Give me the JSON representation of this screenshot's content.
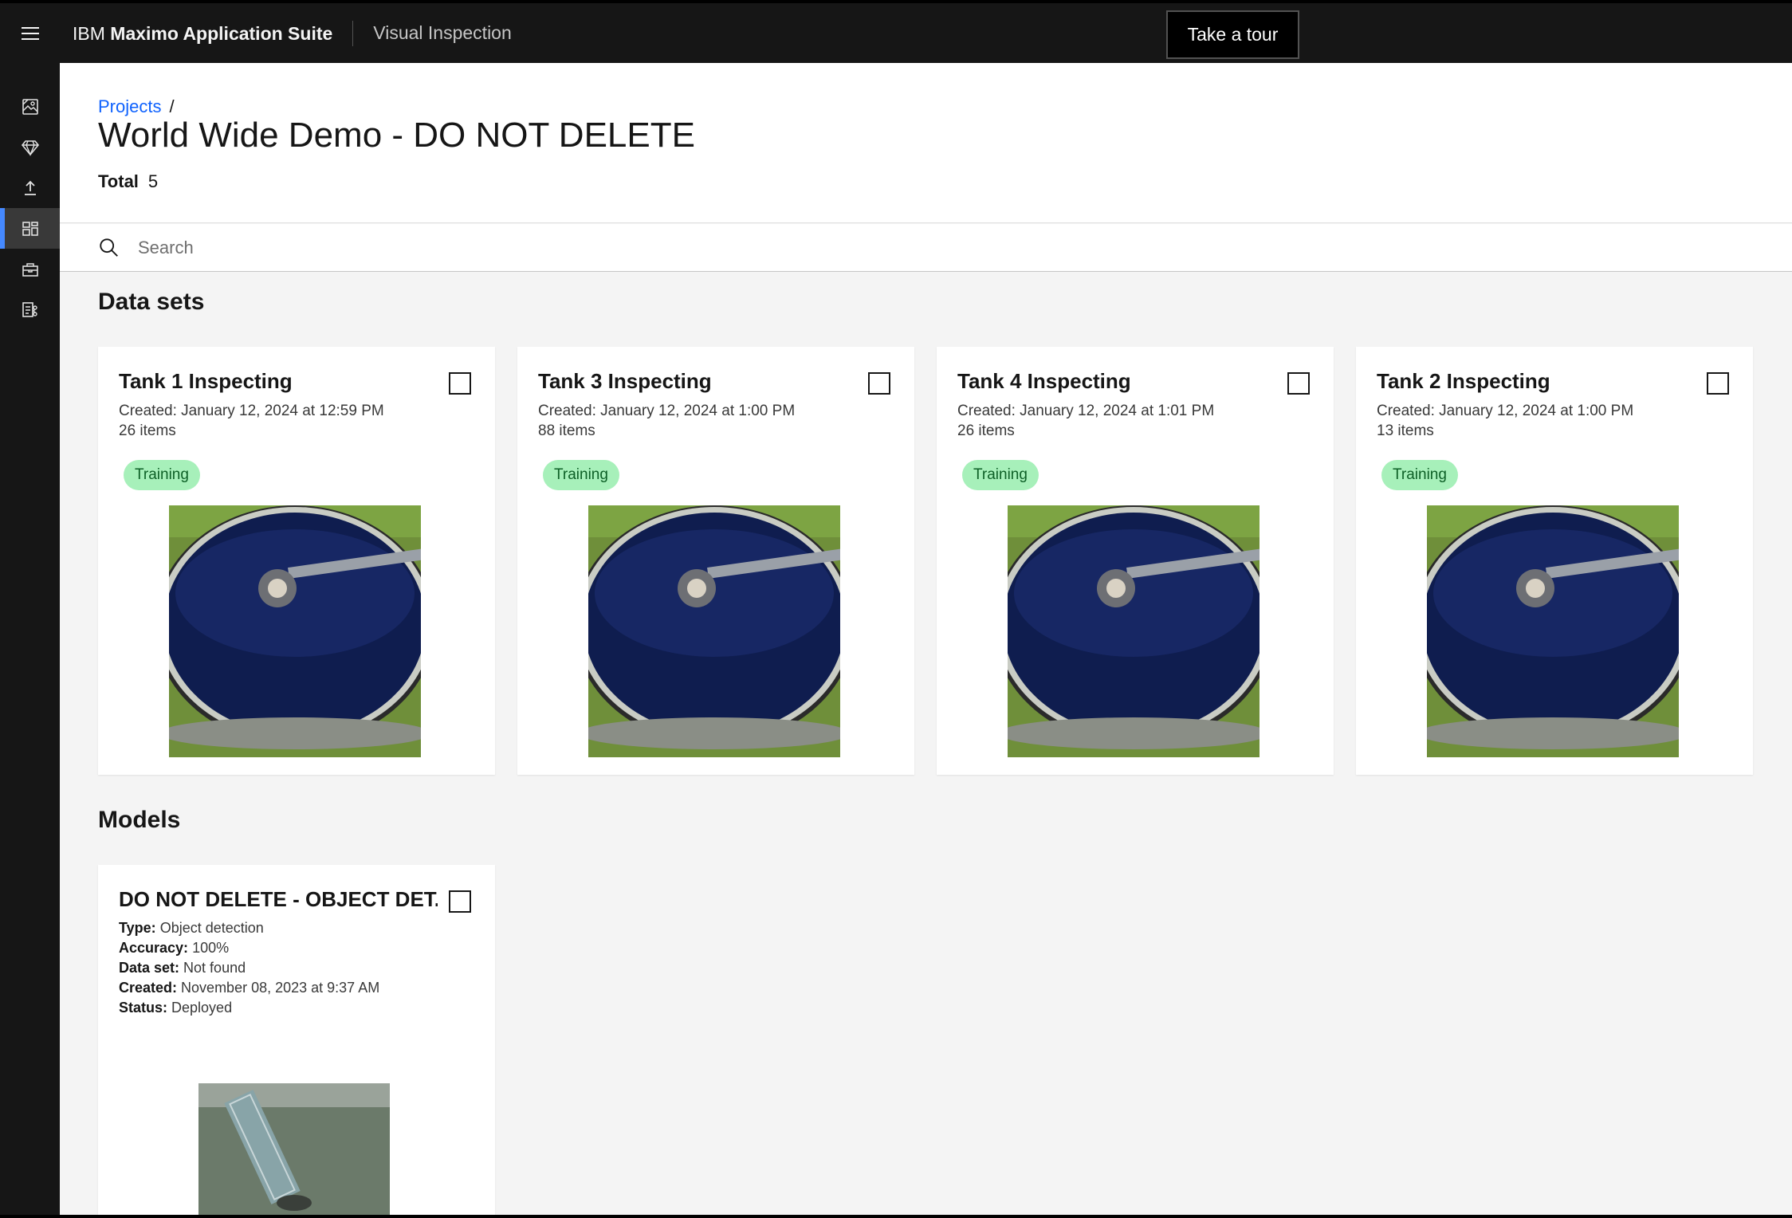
{
  "header": {
    "brand_prefix": "IBM",
    "brand_name": "Maximo Application Suite",
    "product": "Visual Inspection",
    "tour_button": "Take a tour"
  },
  "sidenav": {
    "items": [
      {
        "icon": "image-reference-icon"
      },
      {
        "icon": "gem-icon"
      },
      {
        "icon": "deploy-upload-icon"
      },
      {
        "icon": "dashboard-grid-icon",
        "active": true
      },
      {
        "icon": "toolbox-icon"
      },
      {
        "icon": "data-share-icon"
      }
    ]
  },
  "breadcrumb": {
    "projects": "Projects",
    "separator": "/"
  },
  "page": {
    "title": "World Wide Demo - DO NOT DELETE",
    "total_label": "Total",
    "total_value": "5"
  },
  "search": {
    "placeholder": "Search"
  },
  "sections": {
    "datasets": "Data sets",
    "models": "Models"
  },
  "datasets": [
    {
      "title": "Tank 1 Inspecting",
      "created": "Created: January 12, 2024 at 12:59 PM",
      "items": "26 items",
      "tag": "Training"
    },
    {
      "title": "Tank 3 Inspecting",
      "created": "Created: January 12, 2024 at 1:00 PM",
      "items": "88 items",
      "tag": "Training"
    },
    {
      "title": "Tank 4 Inspecting",
      "created": "Created: January 12, 2024 at 1:01 PM",
      "items": "26 items",
      "tag": "Training"
    },
    {
      "title": "Tank 2 Inspecting",
      "created": "Created: January 12, 2024 at 1:00 PM",
      "items": "13 items",
      "tag": "Training"
    }
  ],
  "models": [
    {
      "title": "DO NOT DELETE - OBJECT DET...",
      "type_label": "Type:",
      "type": "Object detection",
      "accuracy_label": "Accuracy:",
      "accuracy": "100%",
      "dataset_label": "Data set:",
      "dataset": "Not found",
      "created_label": "Created:",
      "created": "November 08, 2023 at 9:37 AM",
      "status_label": "Status:",
      "status": "Deployed"
    }
  ],
  "colors": {
    "header_bg": "#161616",
    "accent": "#0f62fe",
    "active_indicator": "#4589ff",
    "tag_bg": "#a7f0ba",
    "tag_text": "#0e6027"
  }
}
